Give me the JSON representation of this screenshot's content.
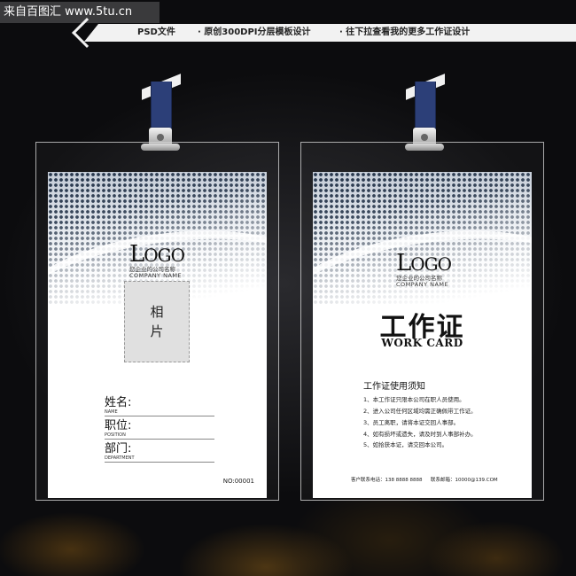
{
  "site_tag": "来自百图汇 www.5tu.cn",
  "banner": {
    "items": [
      "PSD文件",
      "· 原创300DPI分层模板设计",
      "· 往下拉查看我的更多工作证设计"
    ]
  },
  "front_card": {
    "logo": "LOGO",
    "company_cn": "您企业的公司名称",
    "company_en": "COMPANY NAME",
    "photo_line1": "相",
    "photo_line2": "片",
    "fields": [
      {
        "label": "姓名:",
        "en": "NAME"
      },
      {
        "label": "职位:",
        "en": "POSITION"
      },
      {
        "label": "部门:",
        "en": "DEPARTMENT"
      }
    ],
    "card_no": "NO:00001"
  },
  "back_card": {
    "logo": "LOGO",
    "company_cn": "您企业的公司名称",
    "company_en": "COMPANY NAME",
    "title_cn": "工作证",
    "title_en": "WORK CARD",
    "rules_title": "工作证使用须知",
    "rules": [
      "1、本工作证只限本公司在职人员使用。",
      "2、进入公司任何区域均需正确佩带工作证。",
      "3、员工离职，请将本证交回人事部。",
      "4、如有损坏或遗失，请及时到人事部补办。",
      "5、如拾获本证，请交回本公司。"
    ],
    "contact_phone": "客户联系电话：138 8888 8888",
    "contact_email": "联系邮箱：10000@139.COM"
  }
}
